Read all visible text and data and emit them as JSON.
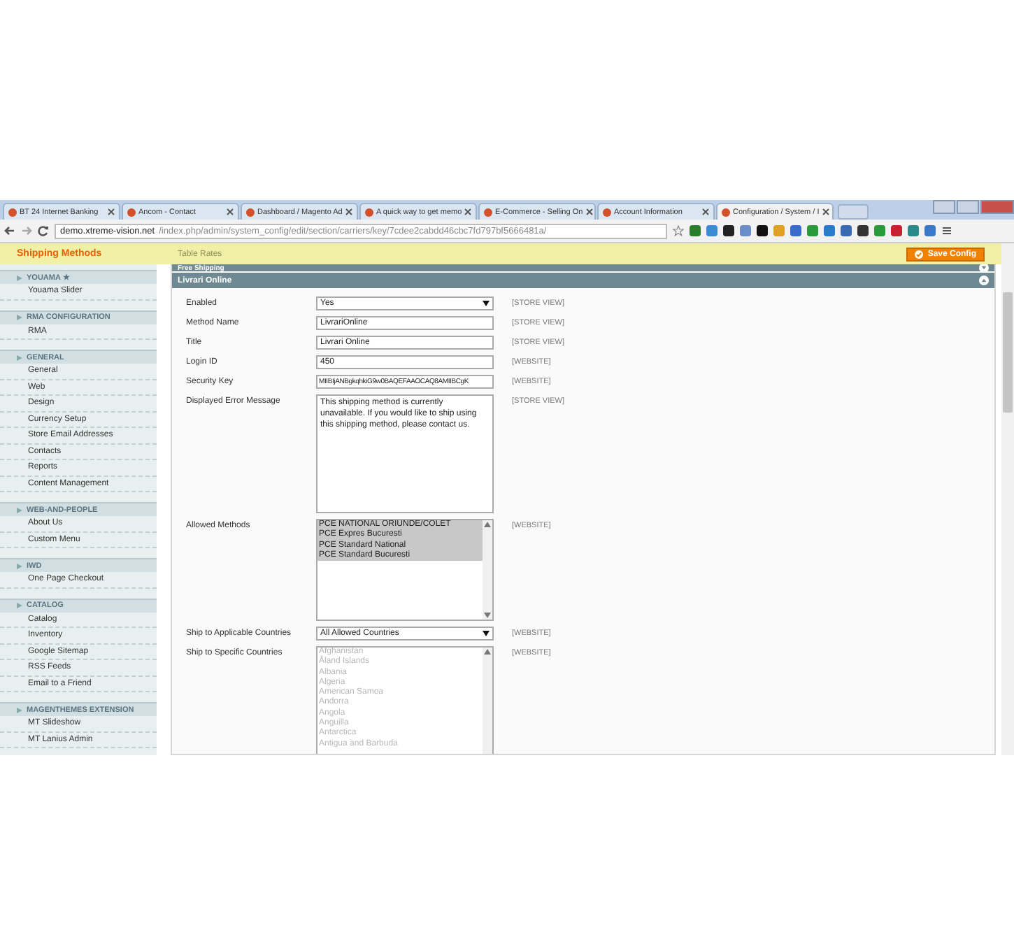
{
  "browser": {
    "tabs": [
      {
        "title": "BT 24 Internet Banking",
        "selected": false
      },
      {
        "title": "Ancom - Contact",
        "selected": false
      },
      {
        "title": "Dashboard / Magento Ad",
        "selected": false
      },
      {
        "title": "A quick way to get memo",
        "selected": false
      },
      {
        "title": "E-Commerce - Selling On",
        "selected": false
      },
      {
        "title": "Account Information",
        "selected": false
      },
      {
        "title": "Configuration / System / I",
        "selected": true
      }
    ],
    "address": {
      "host": "demo.xtreme-vision.net",
      "path": "/index.php/admin/system_config/edit/section/carriers/key/7cdee2cabdd46cbc7fd797bf5666481a/"
    }
  },
  "header": {
    "title": "Shipping Methods",
    "behind": "Table Rates",
    "save_button": "Save Config"
  },
  "sidebar": {
    "groups": [
      {
        "title": "YOUAMA ★",
        "items": [
          "Youama Slider"
        ]
      },
      {
        "title": "RMA CONFIGURATION",
        "items": [
          "RMA"
        ]
      },
      {
        "title": "GENERAL",
        "items": [
          "General",
          "Web",
          "Design",
          "Currency Setup",
          "Store Email Addresses",
          "Contacts",
          "Reports",
          "Content Management"
        ]
      },
      {
        "title": "WEB-AND-PEOPLE",
        "items": [
          "About Us",
          "Custom Menu"
        ]
      },
      {
        "title": "IWD",
        "items": [
          "One Page Checkout"
        ]
      },
      {
        "title": "CATALOG",
        "items": [
          "Catalog",
          "Inventory",
          "Google Sitemap",
          "RSS Feeds",
          "Email to a Friend"
        ]
      },
      {
        "title": "MAGENTHEMES EXTENSION",
        "items": [
          "MT Slideshow",
          "MT Lanius Admin"
        ]
      }
    ]
  },
  "sections": [
    {
      "title": "Free Shipping",
      "expanded": false
    },
    {
      "title": "Livrari Online",
      "expanded": true,
      "fields": [
        {
          "kind": "select",
          "label": "Enabled",
          "value": "Yes",
          "scope": "[STORE VIEW]"
        },
        {
          "kind": "text",
          "label": "Method Name",
          "value": "LivrariOnline",
          "scope": "[STORE VIEW]"
        },
        {
          "kind": "text",
          "label": "Title",
          "value": "Livrari Online",
          "scope": "[STORE VIEW]"
        },
        {
          "kind": "text",
          "label": "Login ID",
          "value": "450",
          "scope": "[WEBSITE]"
        },
        {
          "kind": "text",
          "label": "Security Key",
          "value": "MIIBIjANBgkqhkiG9w0BAQEFAAOCAQ8AMIIBCgK",
          "scope": "[WEBSITE]"
        },
        {
          "kind": "textarea",
          "label": "Displayed Error Message",
          "value": "This shipping method is currently unavailable. If you would like to ship using this shipping method, please contact us.",
          "scope": "[STORE VIEW]"
        },
        {
          "kind": "multiselect",
          "label": "Allowed Methods",
          "scope": "[WEBSITE]",
          "disabled": false,
          "options": [
            {
              "label": "PCE NATIONAL ORIUNDE/COLET",
              "selected": true
            },
            {
              "label": "PCE Expres Bucuresti",
              "selected": true
            },
            {
              "label": "PCE Standard National",
              "selected": true
            },
            {
              "label": "PCE Standard Bucuresti",
              "selected": true
            }
          ]
        },
        {
          "kind": "select",
          "label": "Ship to Applicable Countries",
          "value": "All Allowed Countries",
          "scope": "[WEBSITE]"
        },
        {
          "kind": "multiselect",
          "label": "Ship to Specific Countries",
          "scope": "[WEBSITE]",
          "disabled": true,
          "options": [
            {
              "label": "Afghanistan",
              "selected": false
            },
            {
              "label": "Åland Islands",
              "selected": false
            },
            {
              "label": "Albania",
              "selected": false
            },
            {
              "label": "Algeria",
              "selected": false
            },
            {
              "label": "American Samoa",
              "selected": false
            },
            {
              "label": "Andorra",
              "selected": false
            },
            {
              "label": "Angola",
              "selected": false
            },
            {
              "label": "Anguilla",
              "selected": false
            },
            {
              "label": "Antarctica",
              "selected": false
            },
            {
              "label": "Antigua and Barbuda",
              "selected": false
            }
          ]
        }
      ]
    }
  ]
}
